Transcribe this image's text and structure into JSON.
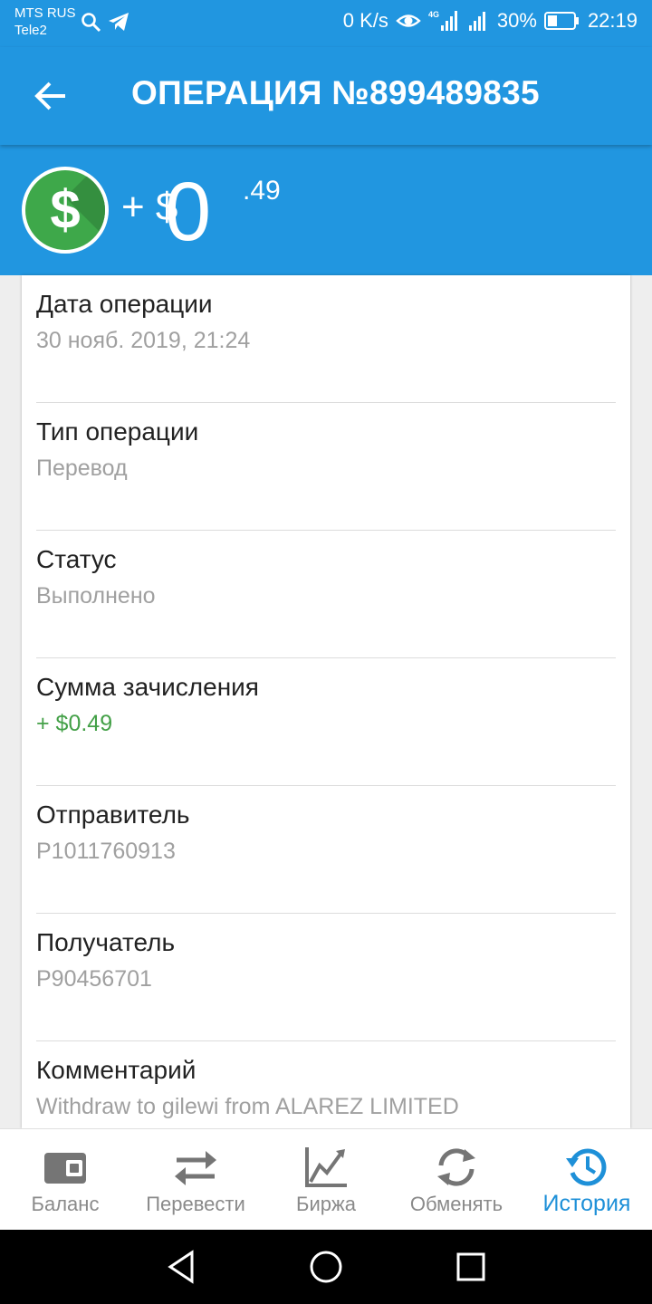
{
  "status_bar": {
    "carrier_primary": "MTS RUS",
    "carrier_secondary": "Tele2",
    "network_speed": "0 K/s",
    "network_type": "4G",
    "battery_percent": "30%",
    "time": "22:19"
  },
  "app_bar": {
    "title": "ОПЕРАЦИЯ №899489835"
  },
  "amount": {
    "prefix": "+ $",
    "integer": "0",
    "fraction": ".49",
    "coin_symbol": "$",
    "coin_color": "#3ea84a"
  },
  "details": [
    {
      "label": "Дата операции",
      "value": "30 нояб. 2019, 21:24"
    },
    {
      "label": "Тип операции",
      "value": "Перевод"
    },
    {
      "label": "Статус",
      "value": "Выполнено"
    },
    {
      "label": "Сумма зачисления",
      "value": "+ $0.49"
    },
    {
      "label": "Отправитель",
      "value": "P1011760913"
    },
    {
      "label": "Получатель",
      "value": "P90456701"
    },
    {
      "label": "Комментарий",
      "value": "Withdraw to gilewi from ALAREZ LIMITED"
    }
  ],
  "bottom_nav": {
    "items": [
      {
        "label": "Баланс",
        "icon": "wallet-icon"
      },
      {
        "label": "Перевести",
        "icon": "transfer-icon"
      },
      {
        "label": "Биржа",
        "icon": "chart-icon"
      },
      {
        "label": "Обменять",
        "icon": "exchange-icon"
      },
      {
        "label": "История",
        "icon": "history-icon"
      }
    ],
    "active_index": 4
  },
  "colors": {
    "primary": "#2196e0",
    "accent_active": "#1e90d8",
    "positive": "#43a047",
    "muted_text": "#a0a0a0"
  }
}
